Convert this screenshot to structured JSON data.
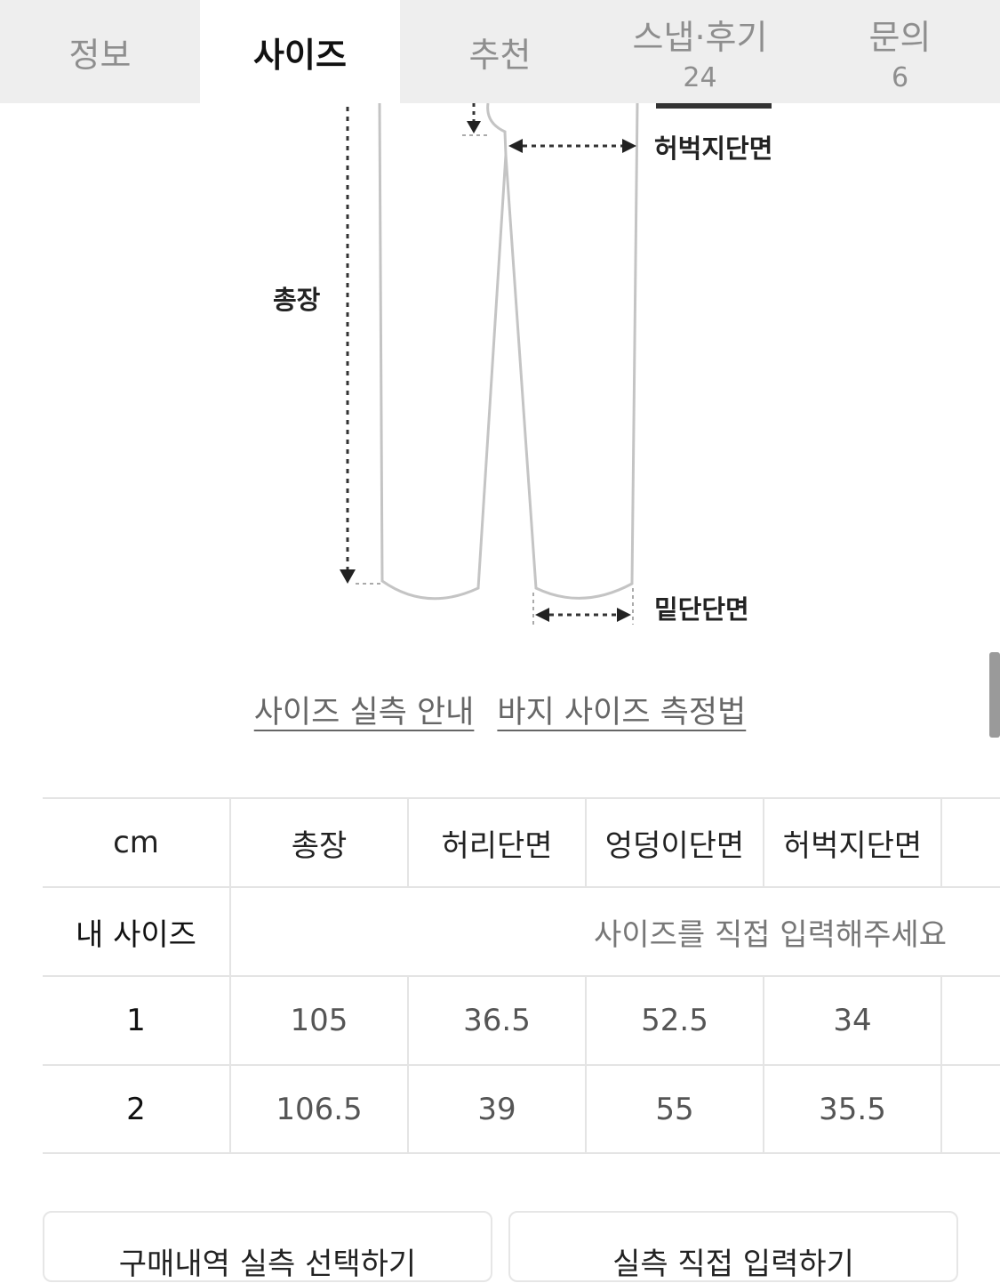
{
  "tabs": [
    {
      "label": "정보",
      "count": ""
    },
    {
      "label": "사이즈",
      "count": ""
    },
    {
      "label": "추천",
      "count": ""
    },
    {
      "label": "스냅·후기",
      "count": "24"
    },
    {
      "label": "문의",
      "count": "6"
    }
  ],
  "active_tab": "사이즈",
  "diagram": {
    "labels": {
      "thigh": "허벅지단면",
      "length": "총장",
      "hem": "밑단단면"
    }
  },
  "guide_links": {
    "size_guide": "사이즈 실측 안내",
    "measure_guide": "바지 사이즈 측정법"
  },
  "size_table": {
    "headers": [
      "cm",
      "총장",
      "허리단면",
      "엉덩이단면",
      "허벅지단면"
    ],
    "my_size": {
      "label": "내 사이즈",
      "placeholder": "사이즈를 직접 입력해주세요"
    },
    "rows": [
      {
        "size": "1",
        "values": [
          "105",
          "36.5",
          "52.5",
          "34"
        ]
      },
      {
        "size": "2",
        "values": [
          "106.5",
          "39",
          "55",
          "35.5"
        ]
      }
    ]
  },
  "buttons": {
    "purchase_select": "구매내역 실측 선택하기",
    "direct_input": "실측 직접 입력하기"
  }
}
